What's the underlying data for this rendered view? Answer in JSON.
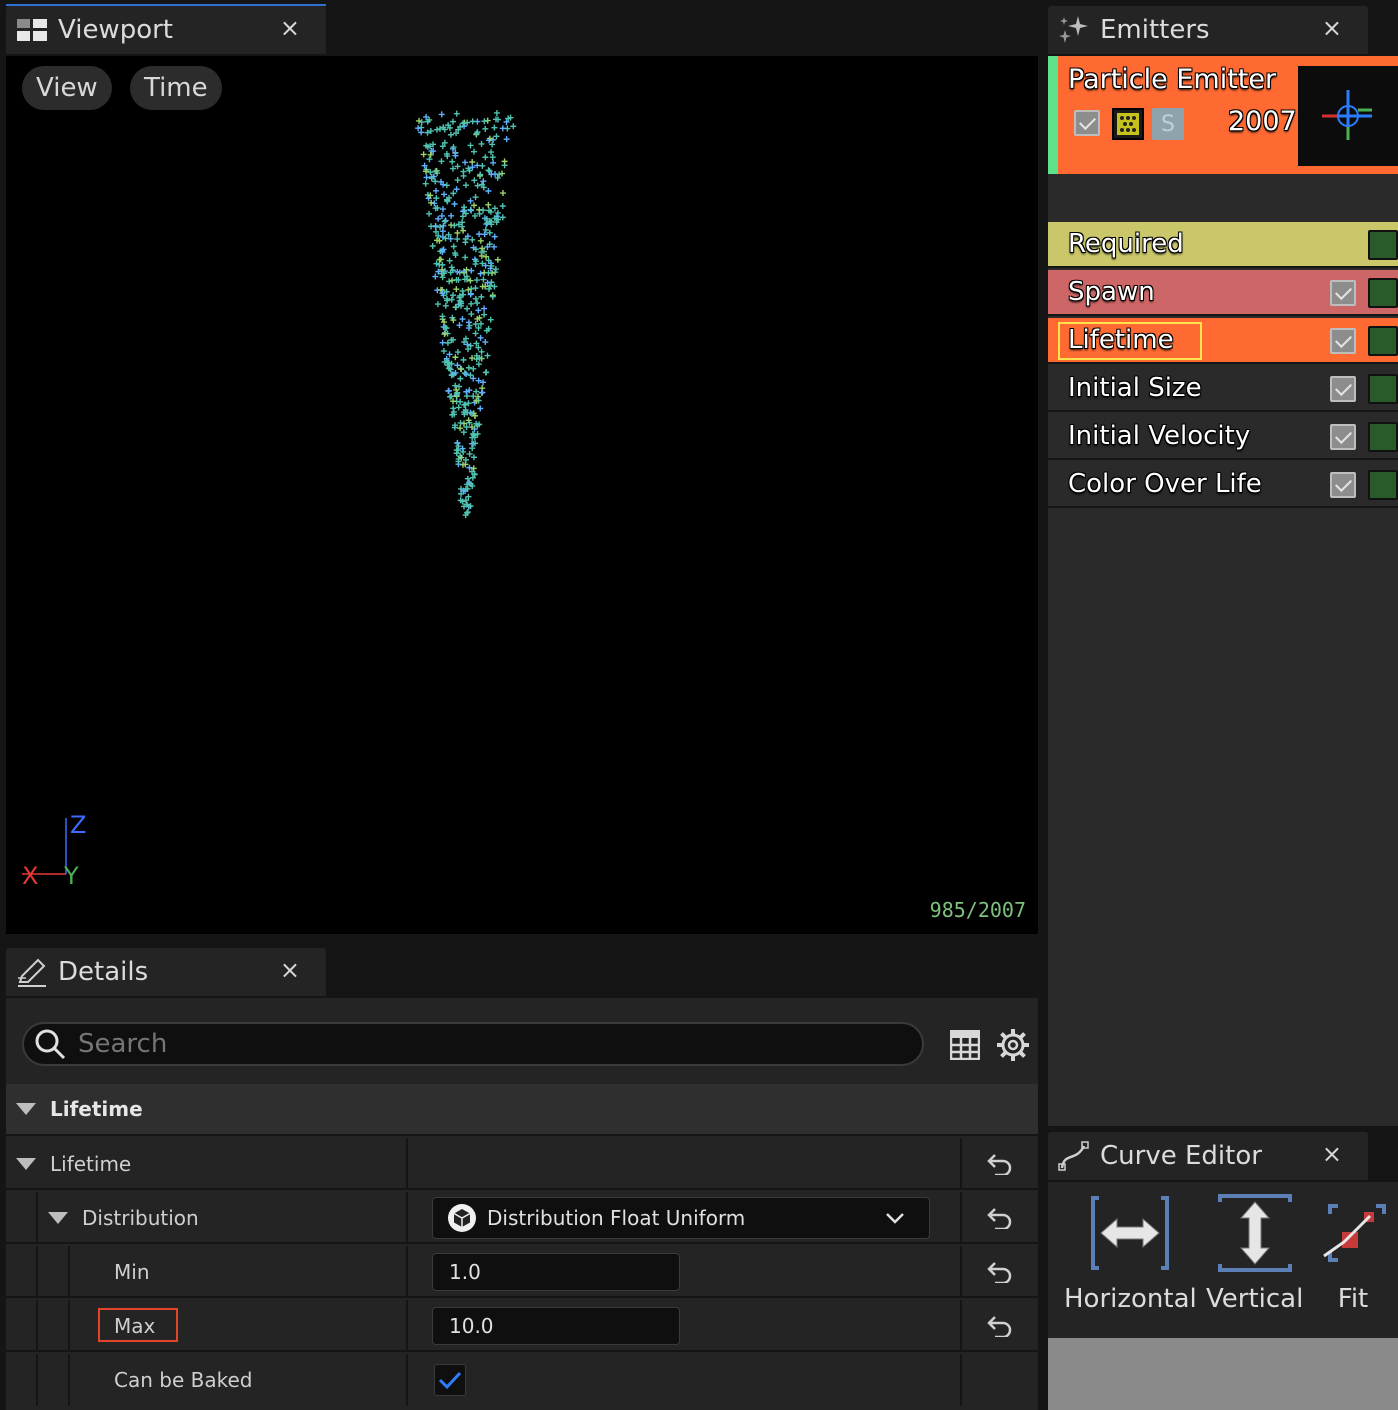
{
  "viewport": {
    "tab_title": "Viewport",
    "close_glyph": "×",
    "menu": [
      "View",
      "Time"
    ],
    "axes": {
      "x": "X",
      "y": "Y",
      "z": "Z"
    },
    "particle_count": "985/2007"
  },
  "emitters": {
    "tab_title": "Emitters",
    "close_glyph": "×",
    "emitter": {
      "name": "Particle Emitter",
      "count": "2007",
      "solo_label": "S",
      "card_color": "#ff6a32",
      "accent_color": "#5ee28a"
    },
    "modules": [
      {
        "label": "Required",
        "color": "#c9c76a",
        "has_checkbox": false
      },
      {
        "label": "Spawn",
        "color": "#cd6666",
        "has_checkbox": true
      },
      {
        "label": "Lifetime",
        "color": "#ff6a32",
        "has_checkbox": true,
        "selected": true
      },
      {
        "label": "Initial Size",
        "color": "#2a2a2a",
        "has_checkbox": true
      },
      {
        "label": "Initial Velocity",
        "color": "#2a2a2a",
        "has_checkbox": true
      },
      {
        "label": "Color Over Life",
        "color": "#2a2a2a",
        "has_checkbox": true
      }
    ]
  },
  "details": {
    "tab_title": "Details",
    "close_glyph": "×",
    "search_placeholder": "Search",
    "category": "Lifetime",
    "rows": {
      "lifetime": "Lifetime",
      "distribution": "Distribution",
      "distribution_value": "Distribution Float Uniform",
      "min_label": "Min",
      "min_value": "1.0",
      "max_label": "Max",
      "max_value": "10.0",
      "baked_label": "Can be Baked",
      "baked_checked": true
    }
  },
  "curve_editor": {
    "tab_title": "Curve Editor",
    "close_glyph": "×",
    "buttons": [
      "Horizontal",
      "Vertical",
      "Fit"
    ]
  }
}
